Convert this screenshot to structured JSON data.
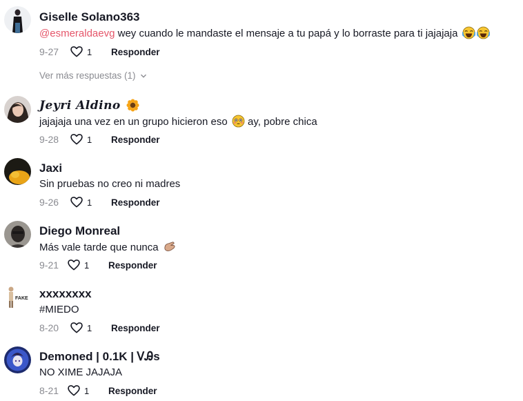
{
  "comments": [
    {
      "username": "Giselle Solano363",
      "mention": "@esmeraldaevg",
      "text": " wey cuando le mandaste el mensaje a tu papá y lo borraste para ti jajajaja",
      "date": "9-27",
      "likes": "1",
      "reply_label": "Responder",
      "emojis": [
        "laughing-crying-emoji",
        "laughing-crying-emoji"
      ]
    },
    {
      "username": "Jeyri Aldino",
      "text": "jajajaja una vez en un grupo hicieron eso",
      "text_after": " ay, pobre chica",
      "date": "9-28",
      "likes": "1",
      "reply_label": "Responder",
      "emojis": [
        "sunflower-emoji",
        "flushed-face-emoji"
      ]
    },
    {
      "username": "Jaxi",
      "text": "Sin pruebas no creo ni madres",
      "date": "9-26",
      "likes": "1",
      "reply_label": "Responder"
    },
    {
      "username": "Diego Monreal",
      "text": "Más vale tarde que nunca",
      "date": "9-21",
      "likes": "1",
      "reply_label": "Responder",
      "emojis": [
        "pinching-hand-emoji"
      ]
    },
    {
      "username": "xxxxxxxx",
      "text": "#MIEDO",
      "date": "8-20",
      "likes": "1",
      "reply_label": "Responder",
      "avatar_label": "FAKE"
    },
    {
      "username": "Demoned | 0.1K | ᏙᎯs",
      "text": "NO XIME JAJAJA",
      "date": "8-21",
      "likes": "1",
      "reply_label": "Responder"
    }
  ],
  "view_more_replies": "Ver más respuestas (1)",
  "colors": {
    "mention": "#e5566a",
    "muted": "#8a8b91",
    "text": "#161823"
  }
}
